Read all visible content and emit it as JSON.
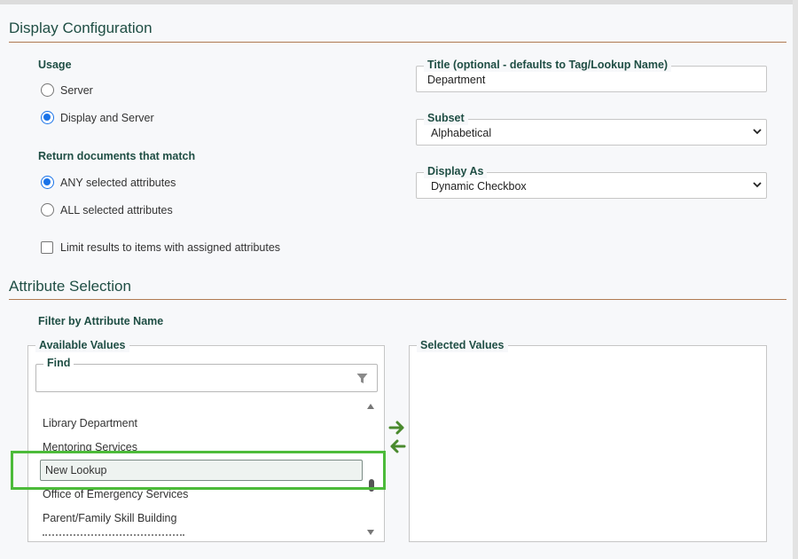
{
  "display_configuration": {
    "title": "Display Configuration",
    "usage": {
      "label": "Usage",
      "options": [
        {
          "label": "Server",
          "checked": false
        },
        {
          "label": "Display and Server",
          "checked": true
        }
      ]
    },
    "return_match": {
      "label": "Return documents that match",
      "options": [
        {
          "label": "ANY selected attributes",
          "checked": true
        },
        {
          "label": "ALL selected attributes",
          "checked": false
        }
      ]
    },
    "limit_checkbox": {
      "label": "Limit results to items with assigned attributes",
      "checked": false
    },
    "title_field": {
      "legend": "Title (optional - defaults to Tag/Lookup Name)",
      "value": "Department"
    },
    "subset_field": {
      "legend": "Subset",
      "value": "Alphabetical"
    },
    "display_as_field": {
      "legend": "Display As",
      "value": "Dynamic Checkbox"
    }
  },
  "attribute_selection": {
    "title": "Attribute Selection",
    "filter_label": "Filter by Attribute Name",
    "available": {
      "legend": "Available Values",
      "find_legend": "Find",
      "find_value": "",
      "items": [
        "Library Department",
        "Mentoring Services",
        "New Lookup",
        "Office of Emergency Services",
        "Parent/Family Skill Building"
      ],
      "selected_item": "New Lookup"
    },
    "selected": {
      "legend": "Selected Values",
      "items": []
    }
  },
  "colors": {
    "heading": "#1f4e44",
    "rule": "#b07a52",
    "radio_accent": "#1a73e8",
    "transfer_arrow": "#4a8a2e",
    "highlight": "#4cbb3a"
  },
  "icons": [
    "chevron-down-icon",
    "filter-icon",
    "arrow-right-icon",
    "arrow-left-icon",
    "scroll-up-icon",
    "scroll-down-icon"
  ]
}
